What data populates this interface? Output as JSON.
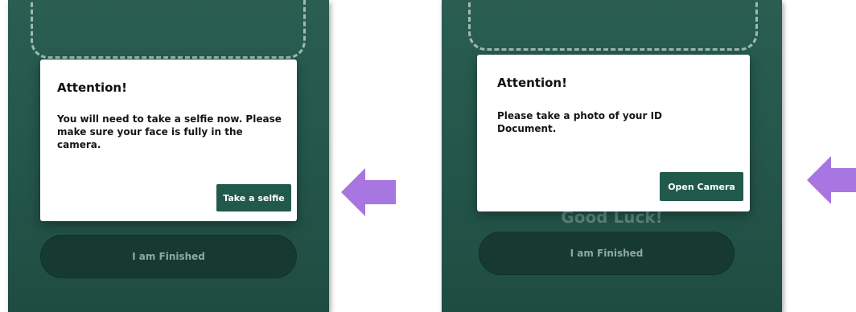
{
  "panels": [
    {
      "dialog_title": "Attention!",
      "dialog_body": "You will need to take a selfie now. Please make sure your face is fully in the camera.",
      "action_label": "Take a selfie",
      "finish_label": "I am Finished"
    },
    {
      "dialog_title": "Attention!",
      "dialog_body": "Please take a photo of your ID Document.",
      "action_label": "Open Camera",
      "background_text": "Good Luck!",
      "finish_label": "I am Finished"
    }
  ],
  "arrows": [
    {
      "icon": "arrow-left-icon",
      "color": "#a876e0"
    },
    {
      "icon": "arrow-left-icon",
      "color": "#a876e0"
    }
  ],
  "colors": {
    "screen_bg": "#24554a",
    "action_button": "#215a4b",
    "finish_button": "#163a31",
    "arrow": "#a876e0"
  }
}
